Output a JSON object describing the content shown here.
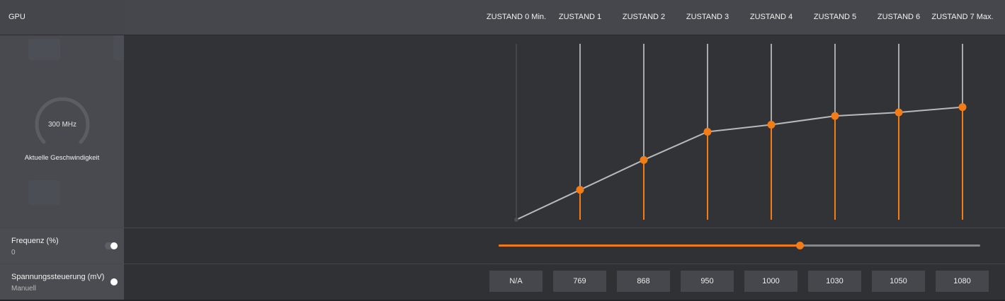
{
  "header": {
    "title": "GPU"
  },
  "states": [
    {
      "label": "ZUSTAND 0 Min.",
      "frequency_pct": 0,
      "voltage": "N/A"
    },
    {
      "label": "ZUSTAND 1",
      "frequency_pct": 17,
      "voltage": "769"
    },
    {
      "label": "ZUSTAND 2",
      "frequency_pct": 34,
      "voltage": "868"
    },
    {
      "label": "ZUSTAND 3",
      "frequency_pct": 50,
      "voltage": "950"
    },
    {
      "label": "ZUSTAND 4",
      "frequency_pct": 54,
      "voltage": "1000"
    },
    {
      "label": "ZUSTAND 5",
      "frequency_pct": 59,
      "voltage": "1030"
    },
    {
      "label": "ZUSTAND 6",
      "frequency_pct": 61,
      "voltage": "1050"
    },
    {
      "label": "ZUSTAND 7 Max.",
      "frequency_pct": 64,
      "voltage": "1080"
    }
  ],
  "gauge": {
    "value": "300 MHz",
    "caption": "Aktuelle Geschwindigkeit"
  },
  "frequency": {
    "title": "Frequenz (%)",
    "value": "0",
    "slider_fraction": 0.625
  },
  "voltage_control": {
    "title": "Spannungssteuerung (mV)",
    "mode": "Manuell"
  },
  "colors": {
    "accent": "#f47c16",
    "curve": "#b9b9b9",
    "vertical_line": "#a9a9a9"
  }
}
